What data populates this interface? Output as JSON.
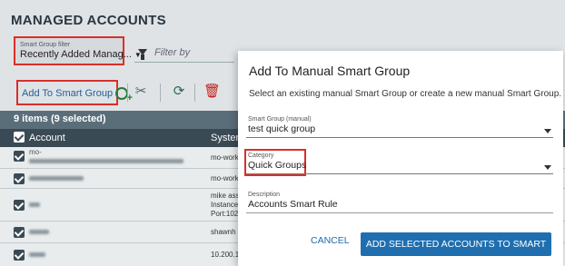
{
  "page": {
    "title": "MANAGED ACCOUNTS"
  },
  "smart_group_filter": {
    "label": "Smart Group filter",
    "value": "Recently Added Manag..."
  },
  "filter_by": {
    "placeholder": "Filter by"
  },
  "toolbar": {
    "add_to_smart_group_label": "Add To Smart Group"
  },
  "grid": {
    "selection_summary": "9 items (9 selected)",
    "columns": [
      "Account",
      "System"
    ],
    "rows": [
      {
        "account": "mo-",
        "system": "mo-work"
      },
      {
        "account": "",
        "system": "mo-work"
      },
      {
        "account": "",
        "system": "mike ass"
      },
      {
        "account": "",
        "system": "shawnh"
      },
      {
        "account": "",
        "system": "10.200.1"
      }
    ],
    "row3_system_extra": [
      "Instance",
      "Port:102"
    ]
  },
  "modal": {
    "title": "Add To Manual Smart Group",
    "description": "Select an existing manual Smart Group or create a new manual Smart Group.",
    "smart_group": {
      "label": "Smart Group (manual)",
      "value": "test quick group"
    },
    "category": {
      "label": "Category",
      "value": "Quick Groups"
    },
    "description_field": {
      "label": "Description",
      "value": "Accounts Smart Rule"
    },
    "cancel_label": "CANCEL",
    "submit_label": "ADD SELECTED ACCOUNTS TO SMART GROUP"
  },
  "colors": {
    "highlight": "#d9302a",
    "primary_button": "#1f6fb0",
    "link": "#1e6aa8",
    "header_dark": "#3a4a55"
  }
}
